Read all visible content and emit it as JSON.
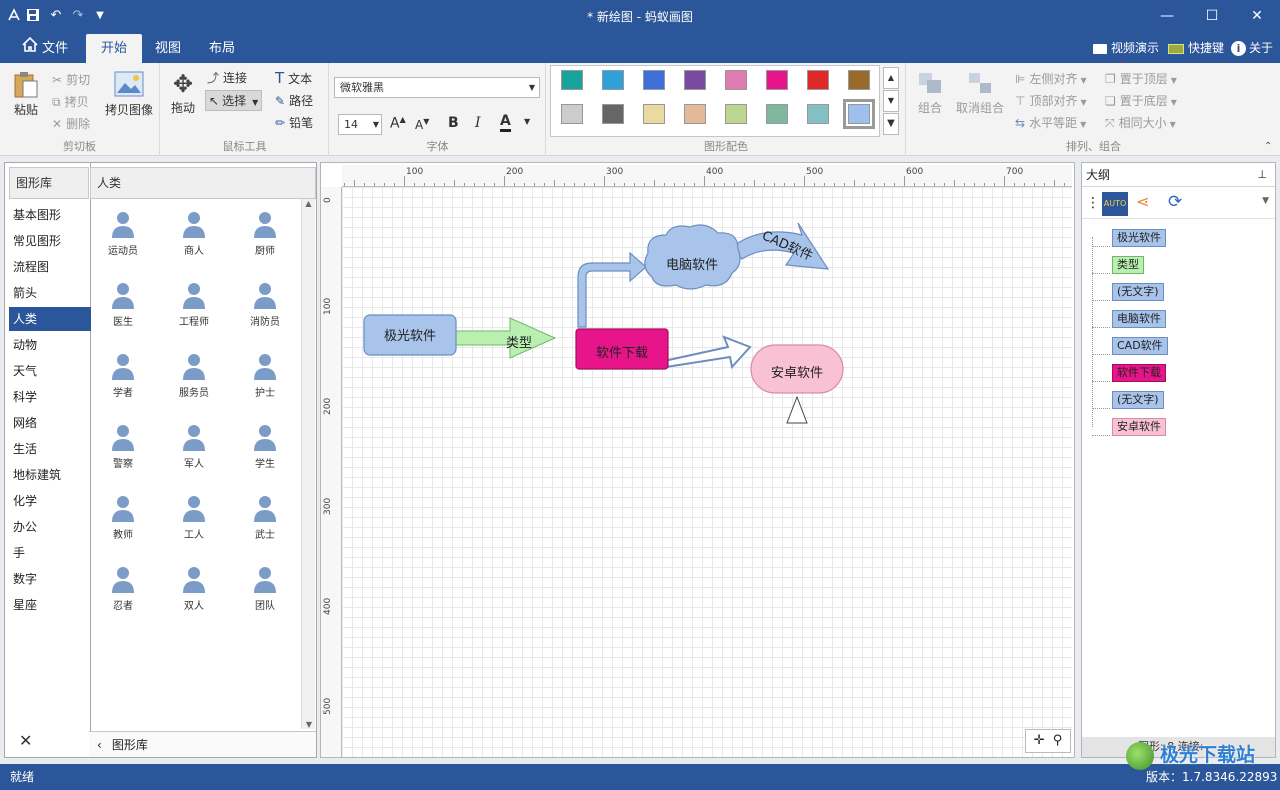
{
  "titlebar": {
    "title": "* 新绘图 - 蚂蚁画图",
    "min": "—",
    "max": "☐",
    "close": "✕"
  },
  "tabs": [
    {
      "label": "文件"
    },
    {
      "label": "开始"
    },
    {
      "label": "视图"
    },
    {
      "label": "布局"
    }
  ],
  "topright": {
    "video": "视频演示",
    "shortcut": "快捷键",
    "about": "关于"
  },
  "ribbon": {
    "clipboard": {
      "label": "剪切板",
      "paste": "粘贴",
      "cut": "剪切",
      "copy": "拷贝",
      "delete": "删除",
      "copy_image": "拷贝图像"
    },
    "mouse": {
      "label": "鼠标工具",
      "drag": "拖动",
      "connect": "连接",
      "select": "选择",
      "text": "文本",
      "path": "路径",
      "pencil": "铅笔"
    },
    "font": {
      "label": "字体",
      "family": "微软雅黑",
      "size": "14",
      "grow": "A",
      "shrink": "A",
      "bold": "B",
      "italic": "I",
      "color": "A"
    },
    "colors": {
      "label": "图形配色",
      "row1": [
        "#1aa39a",
        "#2fa0d8",
        "#3f6fd9",
        "#7a4aa3",
        "#e07ab0",
        "#e8148a",
        "#e02828",
        "#9a6a2a"
      ],
      "row2": [
        "#cccccc",
        "#666666",
        "#ead9a0",
        "#e4b99a",
        "#bcd68f",
        "#7fb89e",
        "#84bfc4",
        "#9fc0ec"
      ]
    },
    "arrange": {
      "label": "排列、组合",
      "group": "组合",
      "ungroup": "取消组合",
      "align_left": "左侧对齐",
      "align_top": "顶部对齐",
      "h_equal": "水平等距",
      "bring_front": "置于顶层",
      "send_back": "置于底层",
      "same_size": "相同大小"
    }
  },
  "library": {
    "header": "图形库",
    "category_header": "人类",
    "categories": [
      "基本图形",
      "常见图形",
      "流程图",
      "箭头",
      "人类",
      "动物",
      "天气",
      "科学",
      "网络",
      "生活",
      "地标建筑",
      "化学",
      "办公",
      "手",
      "数字",
      "星座"
    ],
    "selected": "人类",
    "shapes": [
      "运动员",
      "商人",
      "厨师",
      "医生",
      "工程师",
      "消防员",
      "学者",
      "服务员",
      "护士",
      "警察",
      "军人",
      "学生",
      "教师",
      "工人",
      "武士",
      "忍者",
      "双人",
      "团队"
    ],
    "footer": "图形库",
    "close": "✕"
  },
  "canvas": {
    "ruler_top": [
      "100",
      "200",
      "300",
      "400",
      "500",
      "600",
      "700"
    ],
    "ruler_left": [
      "0",
      "100",
      "200",
      "300",
      "400",
      "500"
    ],
    "shapes": {
      "n1": "极光软件",
      "n2": "类型",
      "n3": "电脑软件",
      "n4": "CAD软件",
      "n5": "软件下载",
      "n6": "安卓软件"
    }
  },
  "outline": {
    "title": "大纲",
    "pin": "📌",
    "items": [
      {
        "label": "极光软件",
        "bg": "#a9c4eb",
        "border": "#6c8ebf"
      },
      {
        "label": "类型",
        "bg": "#b9f0b0",
        "border": "#6fb86a"
      },
      {
        "label": "(无文字)",
        "bg": "#a9c4eb",
        "border": "#6c8ebf"
      },
      {
        "label": "电脑软件",
        "bg": "#a9c4eb",
        "border": "#6c8ebf"
      },
      {
        "label": "CAD软件",
        "bg": "#a9c4eb",
        "border": "#6c8ebf"
      },
      {
        "label": "软件下载",
        "bg": "#e8148a",
        "border": "#a00e60"
      },
      {
        "label": "(无文字)",
        "bg": "#a9c4eb",
        "border": "#6c8ebf"
      },
      {
        "label": "安卓软件",
        "bg": "#f9c2d4",
        "border": "#d98aa5"
      }
    ],
    "footer": "图形: 8    连接:"
  },
  "status": {
    "left": "就绪",
    "version": "版本：1.7.8346.22893"
  },
  "watermark": "极光下载站"
}
